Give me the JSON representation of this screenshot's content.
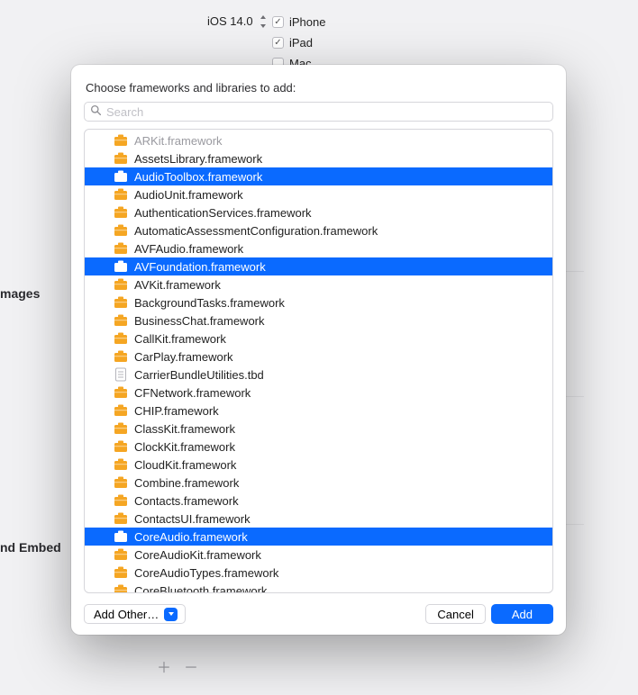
{
  "bg": {
    "deployment_target": "iOS 14.0",
    "devices": [
      {
        "label": "iPhone",
        "checked": true
      },
      {
        "label": "iPad",
        "checked": true
      },
      {
        "label": "Mac",
        "checked": false
      }
    ],
    "section_labels": {
      "images": "mages",
      "embed": "nd Embed"
    }
  },
  "dialog": {
    "title": "Choose frameworks and libraries to add:",
    "search_placeholder": "Search",
    "add_other_label": "Add Other…",
    "cancel_label": "Cancel",
    "add_label": "Add",
    "items": [
      {
        "label": "ARKit.framework",
        "icon": "framework",
        "selected": false,
        "dimmed": true
      },
      {
        "label": "AssetsLibrary.framework",
        "icon": "framework",
        "selected": false
      },
      {
        "label": "AudioToolbox.framework",
        "icon": "framework",
        "selected": true
      },
      {
        "label": "AudioUnit.framework",
        "icon": "framework",
        "selected": false
      },
      {
        "label": "AuthenticationServices.framework",
        "icon": "framework",
        "selected": false
      },
      {
        "label": "AutomaticAssessmentConfiguration.framework",
        "icon": "framework",
        "selected": false
      },
      {
        "label": "AVFAudio.framework",
        "icon": "framework",
        "selected": false
      },
      {
        "label": "AVFoundation.framework",
        "icon": "framework",
        "selected": true
      },
      {
        "label": "AVKit.framework",
        "icon": "framework",
        "selected": false
      },
      {
        "label": "BackgroundTasks.framework",
        "icon": "framework",
        "selected": false
      },
      {
        "label": "BusinessChat.framework",
        "icon": "framework",
        "selected": false
      },
      {
        "label": "CallKit.framework",
        "icon": "framework",
        "selected": false
      },
      {
        "label": "CarPlay.framework",
        "icon": "framework",
        "selected": false
      },
      {
        "label": "CarrierBundleUtilities.tbd",
        "icon": "tbd",
        "selected": false
      },
      {
        "label": "CFNetwork.framework",
        "icon": "framework",
        "selected": false
      },
      {
        "label": "CHIP.framework",
        "icon": "framework",
        "selected": false
      },
      {
        "label": "ClassKit.framework",
        "icon": "framework",
        "selected": false
      },
      {
        "label": "ClockKit.framework",
        "icon": "framework",
        "selected": false
      },
      {
        "label": "CloudKit.framework",
        "icon": "framework",
        "selected": false
      },
      {
        "label": "Combine.framework",
        "icon": "framework",
        "selected": false
      },
      {
        "label": "Contacts.framework",
        "icon": "framework",
        "selected": false
      },
      {
        "label": "ContactsUI.framework",
        "icon": "framework",
        "selected": false
      },
      {
        "label": "CoreAudio.framework",
        "icon": "framework",
        "selected": true
      },
      {
        "label": "CoreAudioKit.framework",
        "icon": "framework",
        "selected": false
      },
      {
        "label": "CoreAudioTypes.framework",
        "icon": "framework",
        "selected": false
      },
      {
        "label": "CoreBluetooth.framework",
        "icon": "framework",
        "selected": false
      }
    ]
  },
  "colors": {
    "accent": "#0a6aff",
    "framework_icon": "#f5a623"
  }
}
